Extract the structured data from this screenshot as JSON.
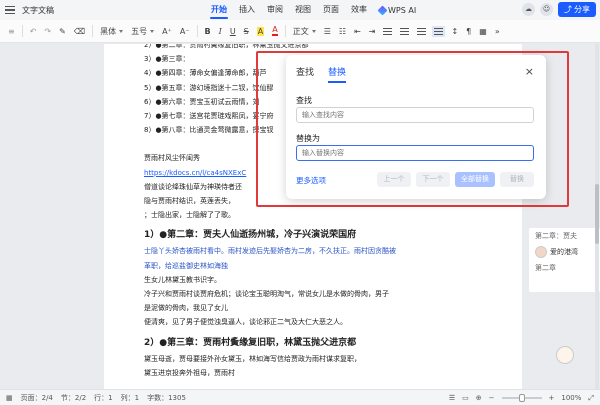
{
  "app": {
    "name": "文字文稿"
  },
  "menus": [
    "开始",
    "插入",
    "审阅",
    "视图",
    "页面",
    "效率"
  ],
  "active_menu": "开始",
  "wps_ai": "WPS AI",
  "share": "分享",
  "toolbar": {
    "font": "黑体",
    "size": "五号",
    "bold": "B",
    "italic": "I",
    "underline": "U",
    "strike": "S",
    "highlight": "A",
    "font_color": "A",
    "style": "正文"
  },
  "doc": {
    "toc": [
      "2）●第二章：贾雨村夤缘复旧职，林黛玉抛父进京都",
      "3）●第三章：",
      "4）●第四章：薄命女偏逢薄命郎，葫芦",
      "5）●第五章：游幻境指迷十二钗，饮仙醪",
      "6）●第六章：贾宝玉初试云雨情，刘",
      "7）●第七章：送宫花贾琏戏熙凤，宴宁府",
      "8）●第八章：比通灵金莺微露意，探宝钗"
    ],
    "title_line": "贾雨村风尘怀闺秀",
    "url": "https://kdocs.cn/l/ca4sNXExC",
    "p1": "僧道谈论绛珠仙草为神瑛侍者还",
    "p2": "隐与贾雨村结识，英莲丢失，",
    "p3": "；士隐出家，士隐解了了歌。",
    "h1": "1）●第二章：贾夫人仙逝扬州城，冷子兴演说荣国府",
    "h1p1": "士隐丫头娇杏被雨村看中。雨村发迹后先娶娇杏为二房，不久扶正。雨村因贪酷被",
    "h1p2": "革职，给巡盐御史林如海独",
    "h1p3": "生女儿林黛玉教书识字。",
    "h1p4": "冷子兴和贾雨村谈贾府危机；谈论宝玉聪明淘气，常说女儿是水做的骨肉，男子",
    "h1p5": "是泥做的骨肉，我见了女儿",
    "h1p6": "便清爽，见了男子便觉浊臭逼人，谈论邪正二气及大仁大恶之人。",
    "h2": "2）●第三章：贾雨村夤缘复旧职，林黛玉抛父进京都",
    "h2p1": "黛玉母逝，贾母要接外孙女黛玉，林如海写信给贾政为雨村谋求复职，",
    "h2p2": "黛玉进京投奔外祖母，贾雨村"
  },
  "sidebar": {
    "top_line": "第二章：贾夫",
    "user": "爱的港湾",
    "chapter": "第二章"
  },
  "dialog": {
    "tab_find": "查找",
    "tab_replace": "替换",
    "active_tab": "替换",
    "close": "×",
    "find_label": "查找",
    "find_placeholder": "输入查找内容",
    "replace_label": "替换为",
    "replace_placeholder": "输入替换内容",
    "more": "更多选项",
    "prev": "上一个",
    "next": "下一个",
    "replace_all": "全部替换",
    "replace": "替换"
  },
  "status": {
    "page": "页面：2/4",
    "section": "节：2/2",
    "row": "行：1",
    "col": "列：1",
    "words": "字数：1305",
    "zoom": "100%"
  },
  "colors": {
    "accent": "#1a5cff",
    "highlight_box": "#e23a3a"
  }
}
